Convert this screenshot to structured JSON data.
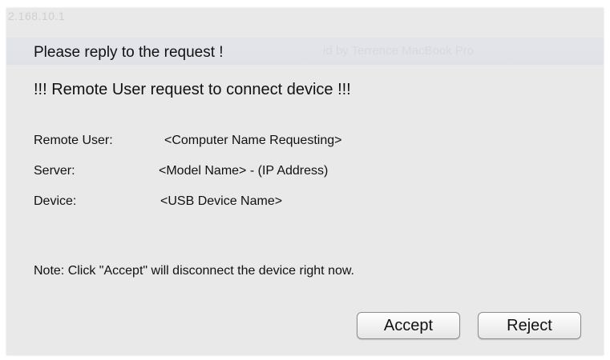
{
  "background": {
    "ghost_ip": "2.168.10.1",
    "ghost_band_text": "id by Terrence MacBook Pro"
  },
  "dialog": {
    "title": "Please reply to the request !",
    "headline": "!!! Remote User request to connect device !!!",
    "fields": [
      {
        "label": "Remote User:",
        "value": "<Computer Name Requesting>"
      },
      {
        "label": "Server:",
        "value": "<Model Name> - (IP Address)"
      },
      {
        "label": "Device:",
        "value": "<USB Device Name>"
      }
    ],
    "note": "Note: Click \"Accept\" will disconnect the device right now.",
    "buttons": {
      "accept": "Accept",
      "reject": "Reject"
    }
  },
  "colors": {
    "dialog_bg": "#e9e9e9",
    "text": "#111111",
    "button_border": "#8c8c8c"
  }
}
